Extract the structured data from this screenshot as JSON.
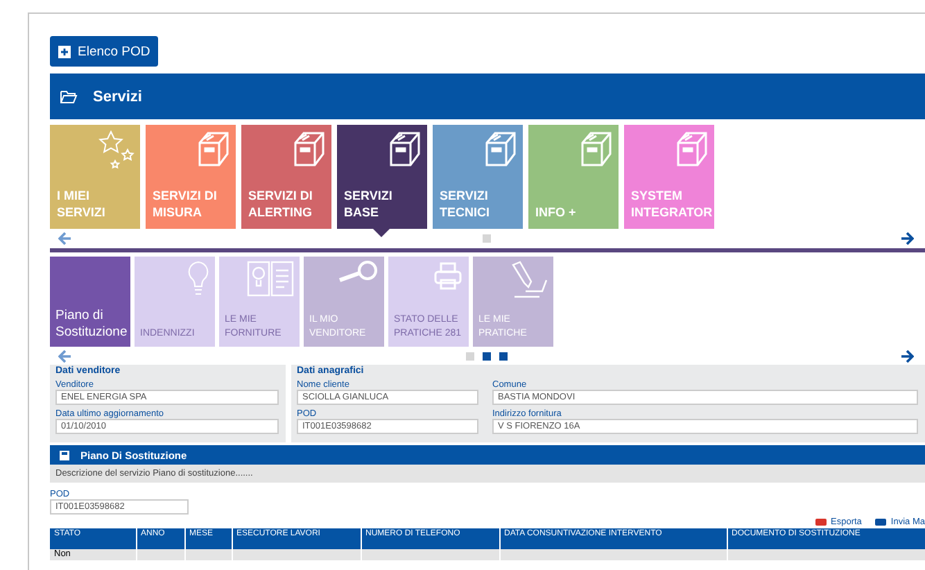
{
  "top_button": {
    "label": "Elenco POD"
  },
  "services_bar": {
    "title": "Servizi"
  },
  "service_tiles": [
    {
      "label": "I MIEI SERVIZI",
      "kind": "stars",
      "color": "#d4b96a",
      "selected": false
    },
    {
      "label": "SERVIZI DI MISURA",
      "kind": "box",
      "color": "#f9876a",
      "selected": false
    },
    {
      "label": "SERVIZI DI ALERTING",
      "kind": "box",
      "color": "#d16569",
      "selected": false
    },
    {
      "label": "SERVIZI BASE",
      "kind": "box",
      "color": "#473466",
      "selected": true
    },
    {
      "label": "SERVIZI TECNICI",
      "kind": "box",
      "color": "#6a9bc8",
      "selected": false
    },
    {
      "label": "INFO +",
      "kind": "box",
      "color": "#95c17f",
      "selected": false
    },
    {
      "label": "SYSTEM INTEGRATOR",
      "kind": "box",
      "color": "#ef83d8",
      "selected": false
    }
  ],
  "service_pager": [
    {
      "selected": false
    }
  ],
  "sub_tiles": [
    {
      "label": "Piano di Sostituzione",
      "kind": "none",
      "selected": true,
      "disabled": false
    },
    {
      "label": "INDENNIZZI",
      "kind": "bulb",
      "selected": false,
      "disabled": true
    },
    {
      "label": "LE MIE FORNITURE",
      "kind": "book",
      "selected": false,
      "disabled": true
    },
    {
      "label": "IL MIO VENDITORE",
      "kind": "key",
      "selected": false,
      "disabled": false
    },
    {
      "label": "STATO DELLE PRATICHE 281",
      "kind": "printer",
      "selected": false,
      "disabled": true
    },
    {
      "label": "LE MIE PRATICHE",
      "kind": "pen",
      "selected": false,
      "disabled": false
    }
  ],
  "sub_pager": [
    {
      "selected": false
    },
    {
      "selected": true
    },
    {
      "selected": true
    }
  ],
  "seller_panel": {
    "title": "Dati venditore",
    "fields": [
      {
        "label": "Venditore",
        "value": "ENEL ENERGIA SPA"
      },
      {
        "label": "Data ultimo aggiornamento",
        "value": "01/10/2010"
      }
    ]
  },
  "registry_panel": {
    "title": "Dati anagrafici",
    "fields": [
      {
        "label": "Nome cliente",
        "value": "SCIOLLA GIANLUCA"
      },
      {
        "label": "Comune",
        "value": "BASTIA MONDOVI"
      },
      {
        "label": "POD",
        "value": "IT001E03598682"
      },
      {
        "label": "Indirizzo fornitura",
        "value": "V S FIORENZO 16A"
      }
    ]
  },
  "plan_section": {
    "title": "Piano Di Sostituzione",
    "description": "Descrizione del servizio Piano di sostituzione......."
  },
  "pod_field": {
    "label": "POD",
    "value": "IT001E03598682"
  },
  "actions": [
    {
      "label": "Esporta",
      "kind": "export"
    },
    {
      "label": "Invia Ma",
      "kind": "mail"
    }
  ],
  "table": {
    "columns": [
      "STATO",
      "ANNO",
      "MESE",
      "ESECUTORE LAVORI",
      "NUMERO DI TELEFONO",
      "DATA CONSUNTIVAZIONE INTERVENTO",
      "DOCUMENTO DI SOSTITUZIONE"
    ],
    "rows": [
      [
        "Non",
        "",
        "",
        "",
        "",
        "",
        ""
      ]
    ]
  }
}
